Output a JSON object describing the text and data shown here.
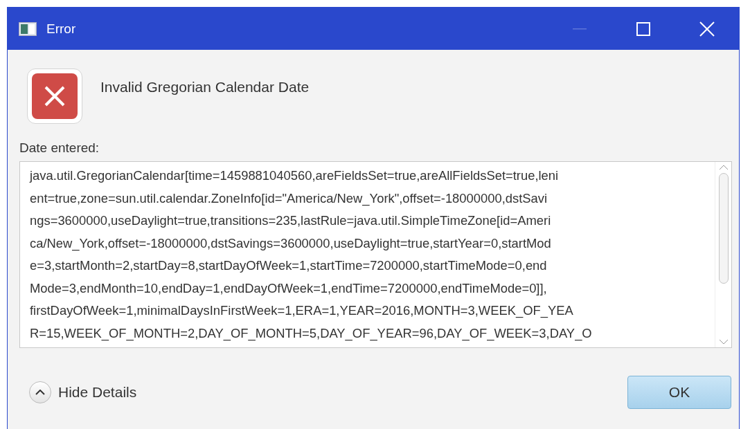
{
  "window": {
    "title": "Error",
    "controls": [
      {
        "kind": "minimize",
        "disabled": true
      },
      {
        "kind": "maximize",
        "disabled": false
      },
      {
        "kind": "close",
        "disabled": false
      }
    ]
  },
  "header": {
    "message": "Invalid Gregorian Calendar Date"
  },
  "details": {
    "label": "Date entered:",
    "lines": [
      "java.util.GregorianCalendar[time=1459881040560,areFieldsSet=true,areAllFieldsSet=true,leni",
      "ent=true,zone=sun.util.calendar.ZoneInfo[id=\"America/New_York\",offset=-18000000,dstSavi",
      "ngs=3600000,useDaylight=true,transitions=235,lastRule=java.util.SimpleTimeZone[id=Ameri",
      "ca/New_York,offset=-18000000,dstSavings=3600000,useDaylight=true,startYear=0,startMod",
      "e=3,startMonth=2,startDay=8,startDayOfWeek=1,startTime=7200000,startTimeMode=0,end",
      "Mode=3,endMonth=10,endDay=1,endDayOfWeek=1,endTime=7200000,endTimeMode=0]],",
      "firstDayOfWeek=1,minimalDaysInFirstWeek=1,ERA=1,YEAR=2016,MONTH=3,WEEK_OF_YEA",
      "R=15,WEEK_OF_MONTH=2,DAY_OF_MONTH=5,DAY_OF_YEAR=96,DAY_OF_WEEK=3,DAY_O"
    ]
  },
  "footer": {
    "toggle": {
      "label": "Hide Details",
      "expanded": true
    },
    "buttons": [
      "OK"
    ]
  }
}
